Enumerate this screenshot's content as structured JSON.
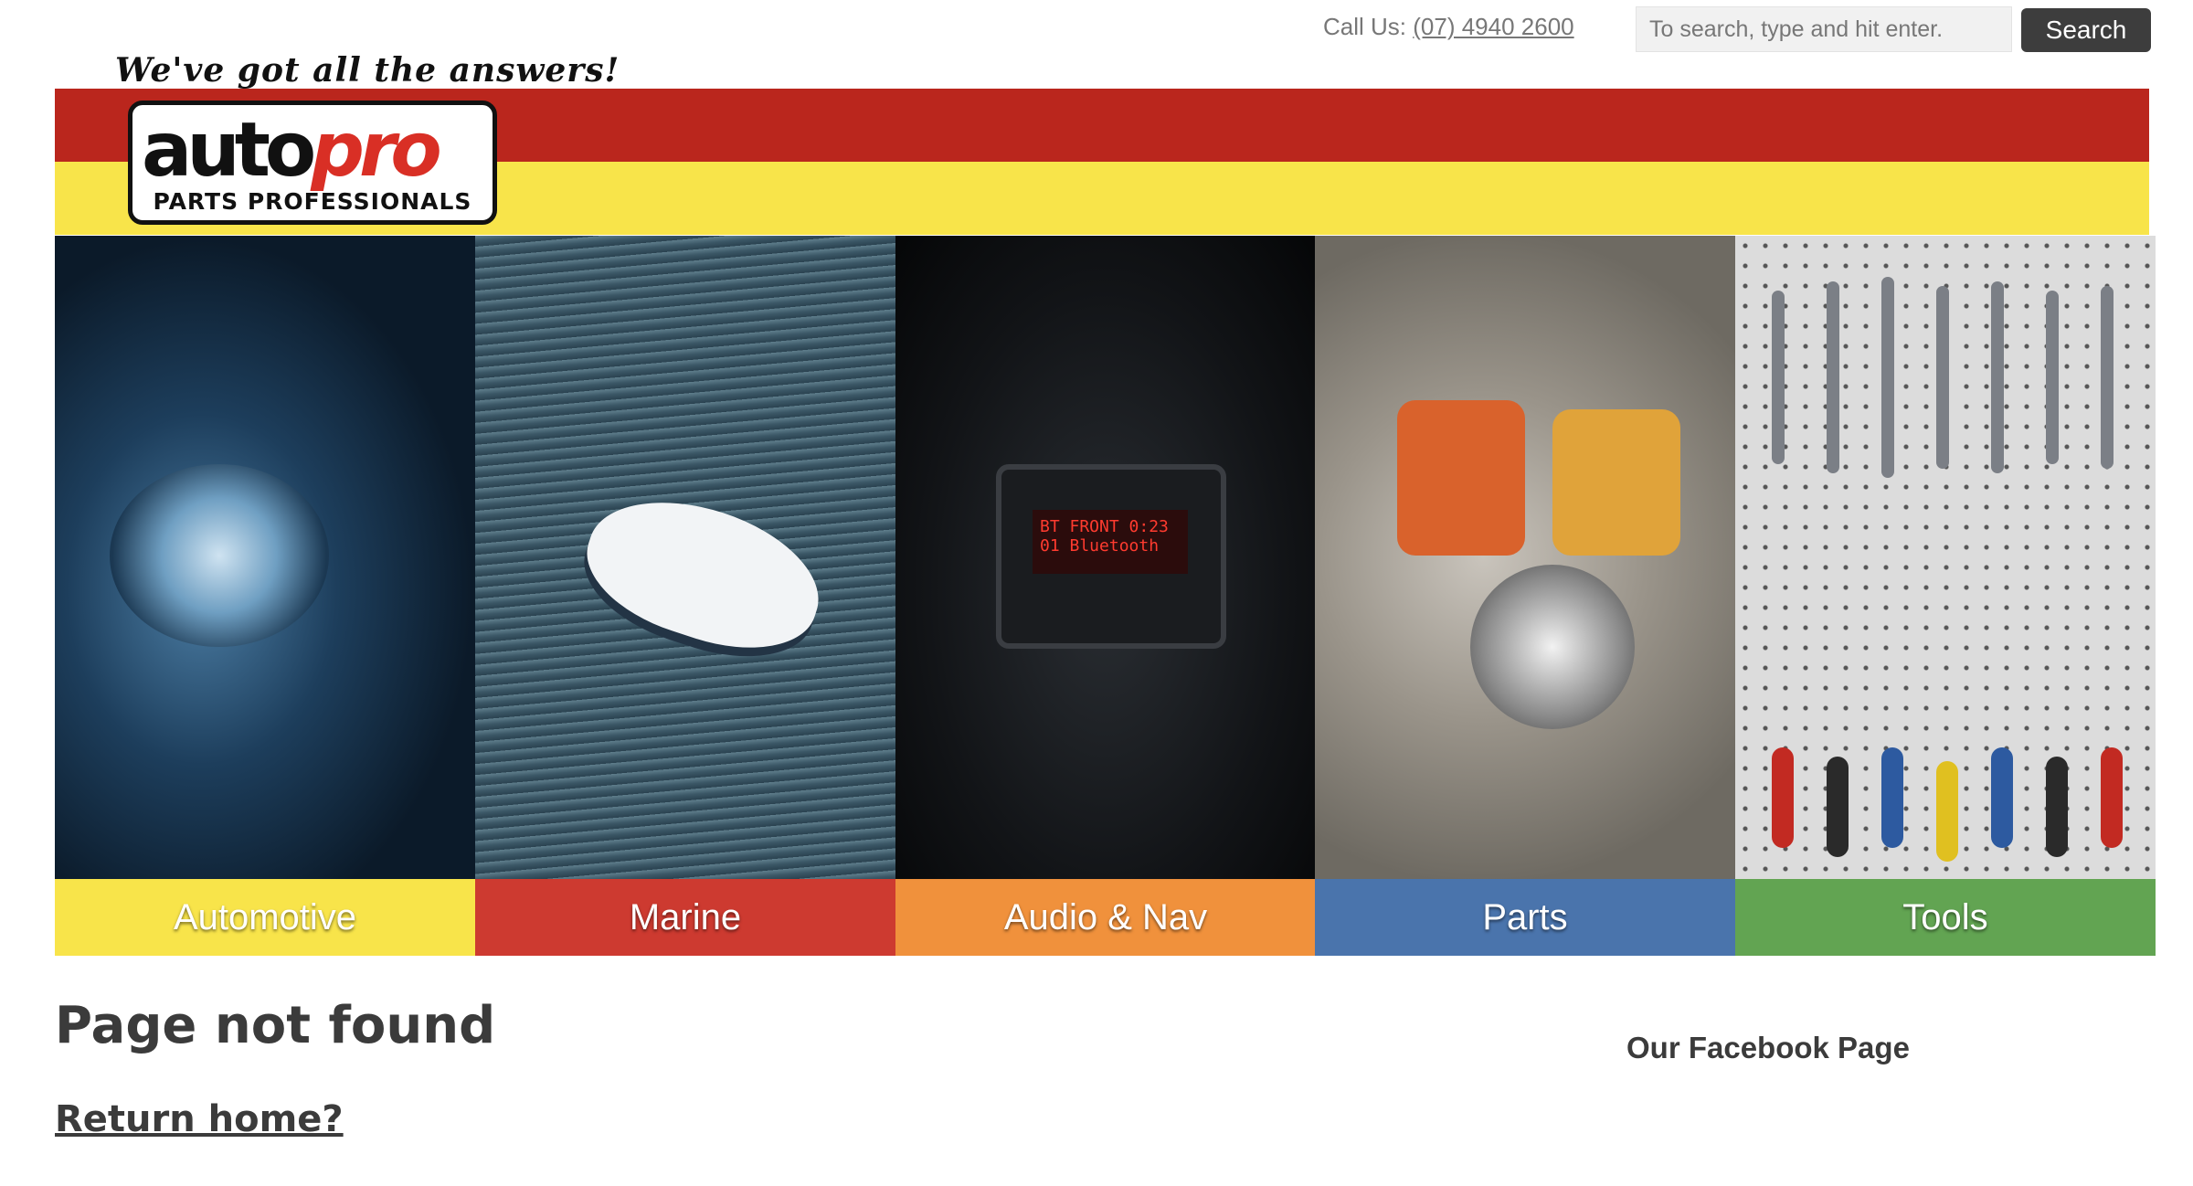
{
  "header": {
    "call_label": "Call Us:",
    "phone": "(07) 4940 2600",
    "search": {
      "placeholder": "To search, type and hit enter.",
      "value": "",
      "button_label": "Search"
    }
  },
  "branding": {
    "tagline": "We've got all the answers!",
    "logo_word_1": "auto",
    "logo_word_2": "pro",
    "logo_sub": "PARTS PROFESSIONALS",
    "colors": {
      "band_red": "#ba261d",
      "band_yellow": "#f8e44a"
    }
  },
  "categories": [
    {
      "label": "Automotive",
      "color": "#f8e44a"
    },
    {
      "label": "Marine",
      "color": "#cd3a30"
    },
    {
      "label": "Audio & Nav",
      "color": "#f0913c"
    },
    {
      "label": "Parts",
      "color": "#4a74ac"
    },
    {
      "label": "Tools",
      "color": "#62a452"
    }
  ],
  "radio_display": "BT FRONT  0:23\n01 Bluetooth",
  "main": {
    "title": "Page not found",
    "return_link": "Return home?"
  },
  "sidebar": {
    "facebook_heading": "Our Facebook Page"
  }
}
